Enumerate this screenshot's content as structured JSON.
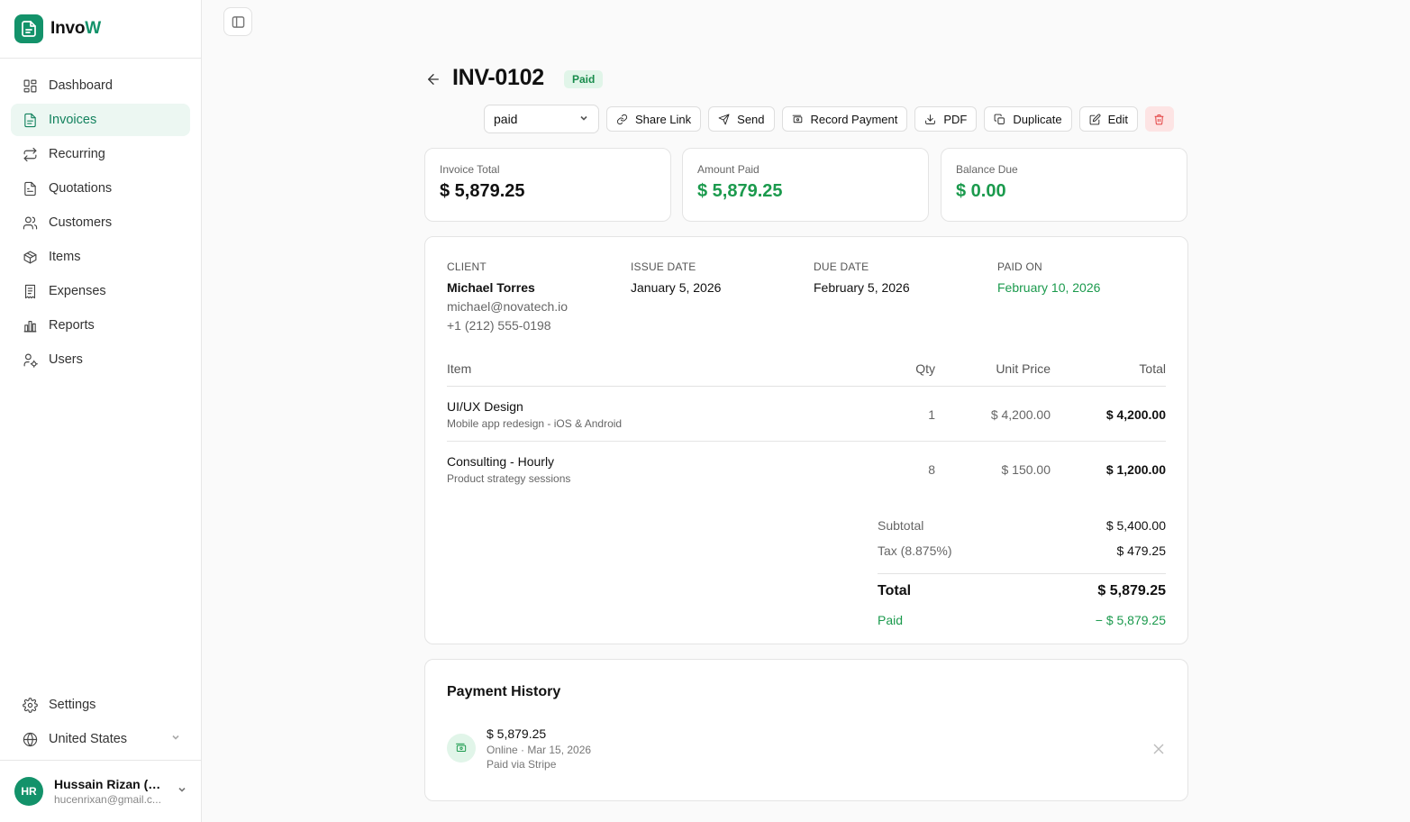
{
  "app": {
    "brand_main": "Invo",
    "brand_accent": "W",
    "accent_color": "#13926a"
  },
  "sidebar": {
    "items": [
      {
        "label": "Dashboard",
        "icon": "grid-icon"
      },
      {
        "label": "Invoices",
        "icon": "file-text-icon",
        "active": true
      },
      {
        "label": "Recurring",
        "icon": "repeat-icon"
      },
      {
        "label": "Quotations",
        "icon": "file-icon"
      },
      {
        "label": "Customers",
        "icon": "users-icon"
      },
      {
        "label": "Items",
        "icon": "package-icon"
      },
      {
        "label": "Expenses",
        "icon": "receipt-icon"
      },
      {
        "label": "Reports",
        "icon": "bar-chart-icon"
      },
      {
        "label": "Users",
        "icon": "user-cog-icon"
      }
    ],
    "settings_label": "Settings",
    "region_label": "United States",
    "user": {
      "initials": "HR",
      "name": "Hussain Rizan (E...",
      "email": "hucenrixan@gmail.c..."
    }
  },
  "invoice": {
    "number": "INV-0102",
    "status_badge": "Paid",
    "status_select_value": "paid"
  },
  "toolbar": {
    "share_label": "Share Link",
    "send_label": "Send",
    "record_label": "Record Payment",
    "pdf_label": "PDF",
    "duplicate_label": "Duplicate",
    "edit_label": "Edit"
  },
  "summary": {
    "total_label": "Invoice Total",
    "total_value": "$ 5,879.25",
    "paid_label": "Amount Paid",
    "paid_value": "$ 5,879.25",
    "balance_label": "Balance Due",
    "balance_value": "$ 0.00"
  },
  "details": {
    "client_label": "CLIENT",
    "client_name": "Michael Torres",
    "client_email": "michael@novatech.io",
    "client_phone": "+1 (212) 555-0198",
    "issue_label": "ISSUE DATE",
    "issue_value": "January 5, 2026",
    "due_label": "DUE DATE",
    "due_value": "February 5, 2026",
    "paidon_label": "PAID ON",
    "paidon_value": "February 10, 2026"
  },
  "items_table": {
    "headers": {
      "item": "Item",
      "qty": "Qty",
      "price": "Unit Price",
      "total": "Total"
    },
    "rows": [
      {
        "name": "UI/UX Design",
        "desc": "Mobile app redesign - iOS & Android",
        "qty": "1",
        "price": "$ 4,200.00",
        "total": "$ 4,200.00"
      },
      {
        "name": "Consulting - Hourly",
        "desc": "Product strategy sessions",
        "qty": "8",
        "price": "$ 150.00",
        "total": "$ 1,200.00"
      }
    ]
  },
  "totals": {
    "subtotal_label": "Subtotal",
    "subtotal_value": "$ 5,400.00",
    "tax_label": "Tax (8.875%)",
    "tax_value": "$ 479.25",
    "total_label": "Total",
    "total_value": "$ 5,879.25",
    "paid_label": "Paid",
    "paid_value": "− $ 5,879.25"
  },
  "payment_history": {
    "title": "Payment History",
    "entries": [
      {
        "amount": "$ 5,879.25",
        "meta": "Online · Mar 15, 2026",
        "note": "Paid via Stripe"
      }
    ]
  }
}
